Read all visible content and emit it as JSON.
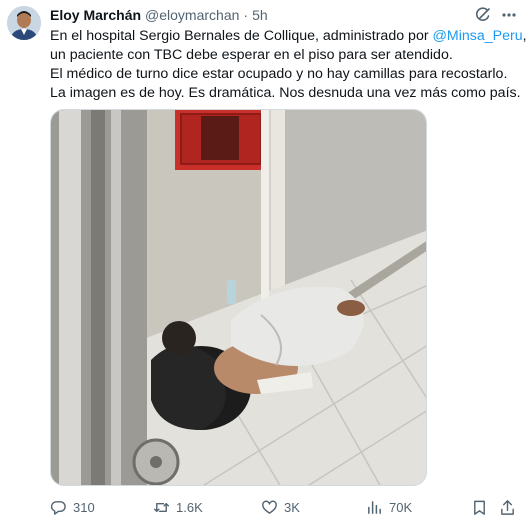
{
  "author": {
    "name": "Eloy Marchán",
    "handle": "@eloymarchan",
    "separator": "·",
    "time": "5h"
  },
  "tweet": {
    "line1_text": "En el hospital Sergio Bernales de Collique, administrado por ",
    "line1_mention": "@Minsa_Peru",
    "line1_suffix": ",",
    "line2": "un paciente con TBC debe esperar en el piso para ser atendido.",
    "line3": "El médico de turno dice estar ocupado y no hay camillas para recostarlo.",
    "line4": "La imagen es de hoy. Es dramática. Nos desnuda una vez más como país."
  },
  "actions": {
    "replies": "310",
    "retweets": "1.6K",
    "likes": "3K",
    "views": "70K"
  },
  "icons": [
    "grok-icon",
    "more-icon",
    "reply-icon",
    "retweet-icon",
    "like-icon",
    "views-icon",
    "bookmark-icon",
    "share-icon"
  ],
  "colors": {
    "accent": "#1d9bf0",
    "muted": "#536471",
    "text": "#0f1419"
  }
}
